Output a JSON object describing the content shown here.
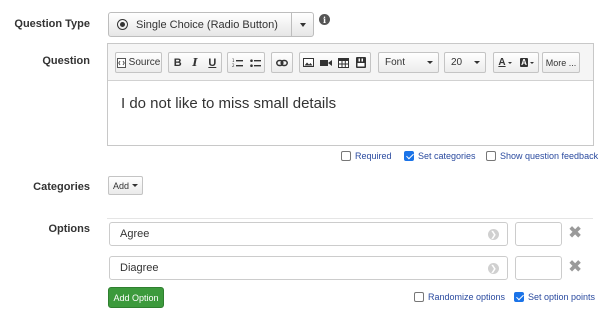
{
  "labels": {
    "question_type": "Question Type",
    "question": "Question",
    "categories": "Categories",
    "options": "Options"
  },
  "question_type": {
    "selected": "Single Choice (Radio Button)"
  },
  "toolbar": {
    "source_label": "Source",
    "bold_label": "B",
    "italic_label": "I",
    "underline_label": "U",
    "font_label": "Font",
    "size_label": "20",
    "text_color_label": "A",
    "bg_color_label": "A",
    "more_label": "More ..."
  },
  "question_text": "I do not like to miss small details",
  "question_flags": [
    {
      "label": "Required",
      "checked": false
    },
    {
      "label": "Set categories",
      "checked": true
    },
    {
      "label": "Show question feedback",
      "checked": false
    }
  ],
  "categories": {
    "add_label": "Add"
  },
  "options": [
    {
      "text": "Agree",
      "points": ""
    },
    {
      "text": "Diagree",
      "points": ""
    }
  ],
  "footer": {
    "add_option_label": "Add Option",
    "randomize_label": "Randomize options",
    "randomize_checked": false,
    "set_points_label": "Set option points",
    "set_points_checked": true
  }
}
